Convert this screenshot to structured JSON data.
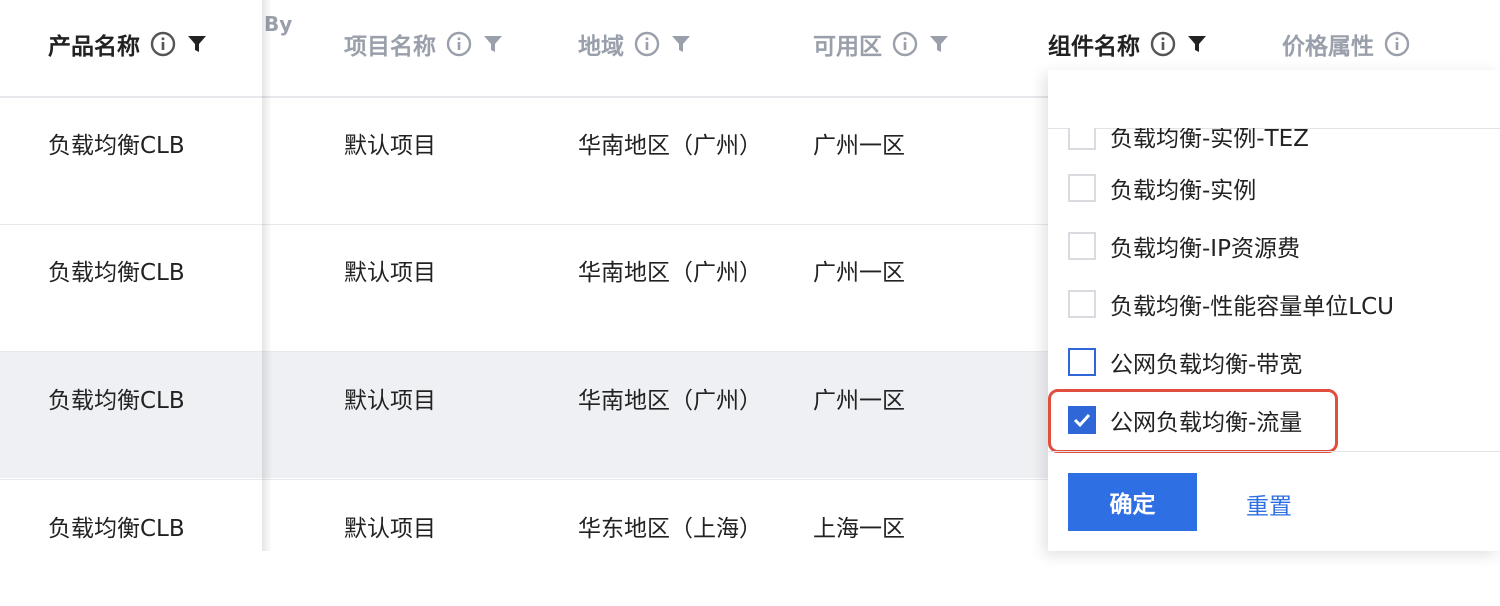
{
  "columns": {
    "product_name": "产品名称",
    "by_fragment": "By",
    "project_name": "项目名称",
    "region": "地域",
    "zone": "可用区",
    "component_name": "组件名称",
    "price_attr": "价格属性"
  },
  "rows": [
    {
      "product": "负载均衡CLB",
      "project": "默认项目",
      "region": "华南地区（广州）",
      "zone": "广州一区"
    },
    {
      "product": "负载均衡CLB",
      "project": "默认项目",
      "region": "华南地区（广州）",
      "zone": "广州一区"
    },
    {
      "product": "负载均衡CLB",
      "project": "默认项目",
      "region": "华南地区（广州）",
      "zone": "广州一区"
    },
    {
      "product": "负载均衡CLB",
      "project": "默认项目",
      "region": "华东地区（上海）",
      "zone": "上海一区"
    }
  ],
  "filter_dropdown": {
    "search_placeholder": "",
    "options": [
      {
        "label": "负载均衡-实例-TEZ",
        "checked": false
      },
      {
        "label": "负载均衡-实例",
        "checked": false
      },
      {
        "label": "负载均衡-IP资源费",
        "checked": false
      },
      {
        "label": "负载均衡-性能容量单位LCU",
        "checked": false
      },
      {
        "label": "公网负载均衡-带宽",
        "checked": false
      },
      {
        "label": "公网负载均衡-流量",
        "checked": true
      }
    ],
    "confirm_label": "确定",
    "reset_label": "重置"
  },
  "colors": {
    "primary": "#2f6fe4",
    "highlight_border": "#e24e3d",
    "hover_row": "#eff0f3"
  }
}
